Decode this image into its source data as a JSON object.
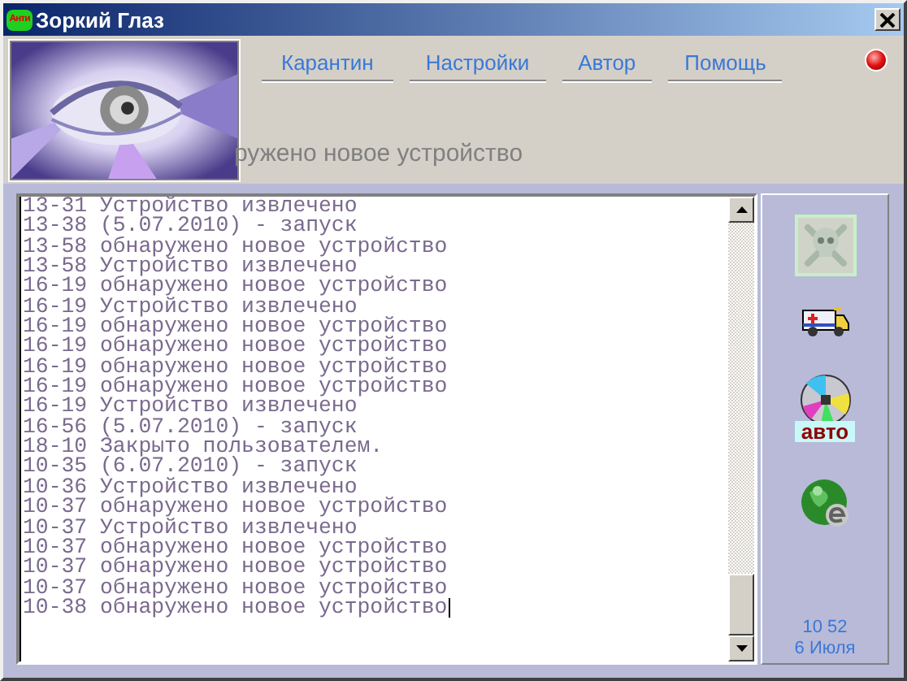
{
  "window": {
    "title": "Зоркий Глаз",
    "app_badge": "Анти"
  },
  "menu": [
    {
      "label": "Карантин"
    },
    {
      "label": "Настройки"
    },
    {
      "label": "Автор"
    },
    {
      "label": "Помощь"
    }
  ],
  "status_text": "ружено новое устройство",
  "log": [
    "13-31 Устройство извлечено",
    "13-38 (5.07.2010) - запуск",
    "13-58 обнаружено новое устройство",
    "13-58 Устройство извлечено",
    "16-19 обнаружено новое устройство",
    "16-19 Устройство извлечено",
    "16-19 обнаружено новое устройство",
    "16-19 обнаружено новое устройство",
    "16-19 обнаружено новое устройство",
    "16-19 обнаружено новое устройство",
    "16-19 Устройство извлечено",
    "16-56 (5.07.2010) - запуск",
    "18-10 Закрыто пользователем.",
    "10-35 (6.07.2010) - запуск",
    "10-36 Устройство извлечено",
    "10-37 обнаружено новое устройство",
    "10-37 Устройство извлечено",
    "10-37 обнаружено новое устройство",
    "10-37 обнаружено новое устройство",
    "10-37 обнаружено новое устройство",
    "10-38 обнаружено новое устройство"
  ],
  "tools": [
    {
      "kind": "skull",
      "selected": true
    },
    {
      "kind": "ambulance",
      "selected": false
    },
    {
      "kind": "disc",
      "label": "авто",
      "selected": false
    },
    {
      "kind": "globe",
      "selected": false
    }
  ],
  "clock": {
    "time": "10 52",
    "date": "6 Июля"
  }
}
